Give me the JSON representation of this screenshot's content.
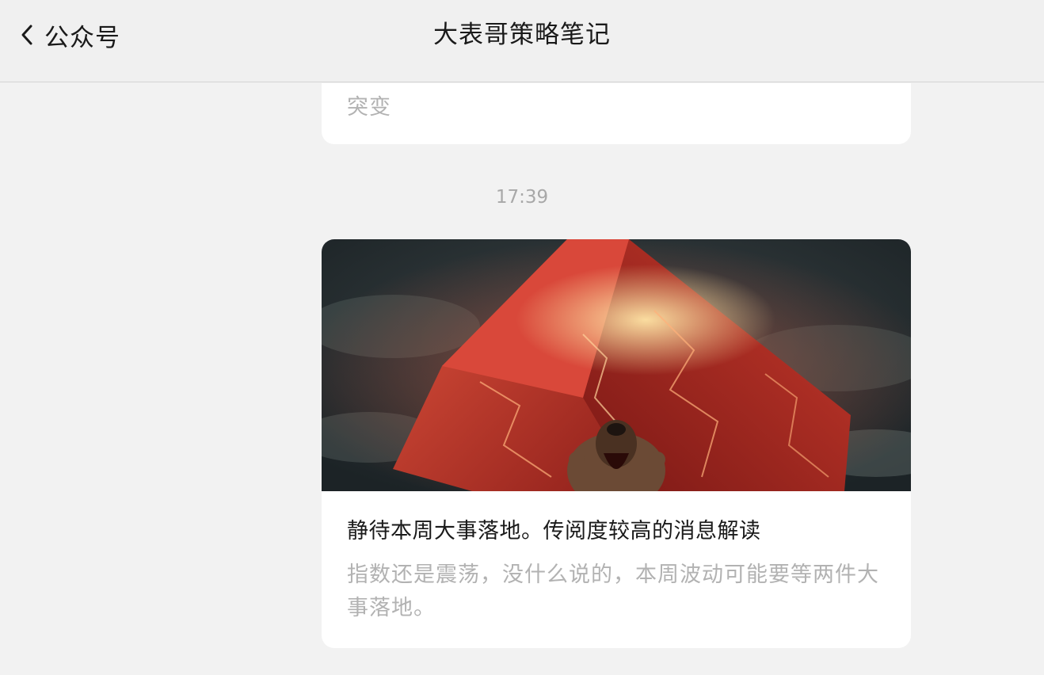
{
  "header": {
    "back_label": "公众号",
    "title": "大表哥策略笔记",
    "back_icon": "chevron-left-icon"
  },
  "messages": {
    "previous_summary_tail": "突变",
    "timestamp": "17:39",
    "article": {
      "title": "静待本周大事落地。传阅度较高的消息解读",
      "description": "指数还是震荡，没什么说的，本周波动可能要等两件大事落地。"
    }
  },
  "colors": {
    "background": "#f2f2f2",
    "card": "#ffffff",
    "title_text": "#1a1a1a",
    "muted_text": "#b2b2b2"
  }
}
